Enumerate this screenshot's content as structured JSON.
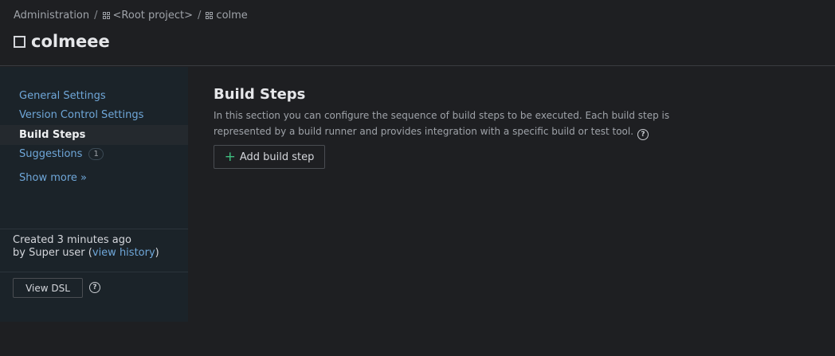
{
  "breadcrumb": {
    "items": [
      "Administration",
      "<Root project>",
      "colme"
    ],
    "separator": "/"
  },
  "page": {
    "title": "colmeee",
    "title_icon": "square-icon"
  },
  "sidebar": {
    "items": [
      {
        "label": "General Settings"
      },
      {
        "label": "Version Control Settings"
      },
      {
        "label": "Build Steps",
        "active": true
      },
      {
        "label": "Suggestions",
        "badge": "1"
      }
    ],
    "show_more": "Show more »",
    "created": "Created 3 minutes ago",
    "by": "by Super user",
    "view_history": "view history",
    "view_dsl": "View DSL"
  },
  "main": {
    "title": "Build Steps",
    "description": "In this section you can configure the sequence of build steps to be executed. Each build step is represented by a build runner and provides integration with a specific build or test tool.",
    "add_button": "Add build step"
  },
  "colors": {
    "link": "#6fa7d9",
    "accent_plus": "#3fbf7f",
    "background": "#1e1f22",
    "sidebar": "#1b2329"
  }
}
